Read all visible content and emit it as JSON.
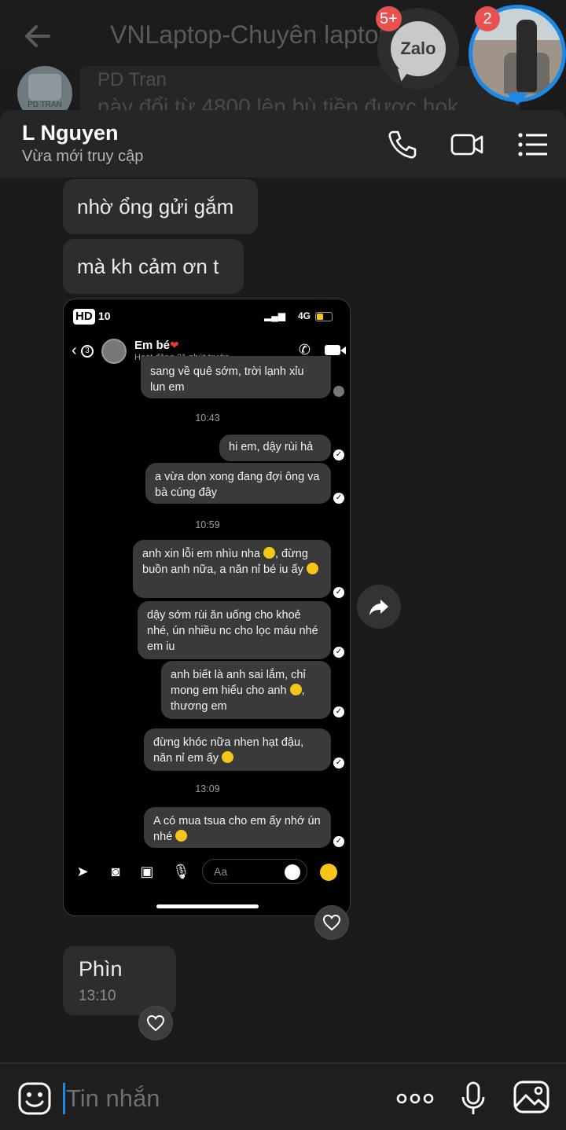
{
  "background_chat": {
    "title": "VNLaptop-Chuyên laptop c",
    "sender": "PD Tran",
    "avatar_label": "PD TRAN",
    "message_preview": "này đổi từ 4800 lên bù tiền được hok"
  },
  "chat_heads": {
    "zalo_label": "Zalo",
    "zalo_badge": "5+",
    "person_badge": "2"
  },
  "header": {
    "name": "L Nguyen",
    "status": "Vừa mới truy cập"
  },
  "messages": {
    "m1": "nhờ ổng gửi gắm",
    "m2": "mà kh cảm ơn t",
    "m3_text": "Phìn",
    "m3_time": "13:10"
  },
  "screenshot": {
    "hd": "HD",
    "time": "10",
    "network": "4G",
    "contact": "Em bé",
    "contact_status": "Hoạt động 21 phút trước",
    "back_count": "3",
    "bubbles": [
      "sang về quê sớm, trời lạnh xỉu lun em",
      "hi em, dậy rùi hả",
      "a vừa dọn xong đang đợi ông va bà cúng đây",
      "anh xin lỗi em nhìu nha",
      "đừng buồn anh nữa, a năn nỉ bé iu ấy",
      "dậy sớm rùi ăn uống cho khoẻ nhé, ún nhiều nc cho lọc máu nhé em iu",
      "anh biết là anh sai lắm, chỉ mong em hiểu cho anh",
      "thương em",
      "đừng khóc nữa nhen hạt đậu, năn nỉ em ấy",
      "A có mua tsua cho em ấy nhớ ún nhé"
    ],
    "timestamps": [
      "10:43",
      "10:59",
      "13:09"
    ],
    "input_placeholder": "Aa"
  },
  "input_bar": {
    "placeholder": "Tin nhắn"
  },
  "colors": {
    "accent": "#1e88e5",
    "badge": "#e8514f",
    "bubble": "#2d2d2d",
    "background": "#1b1b1b"
  }
}
